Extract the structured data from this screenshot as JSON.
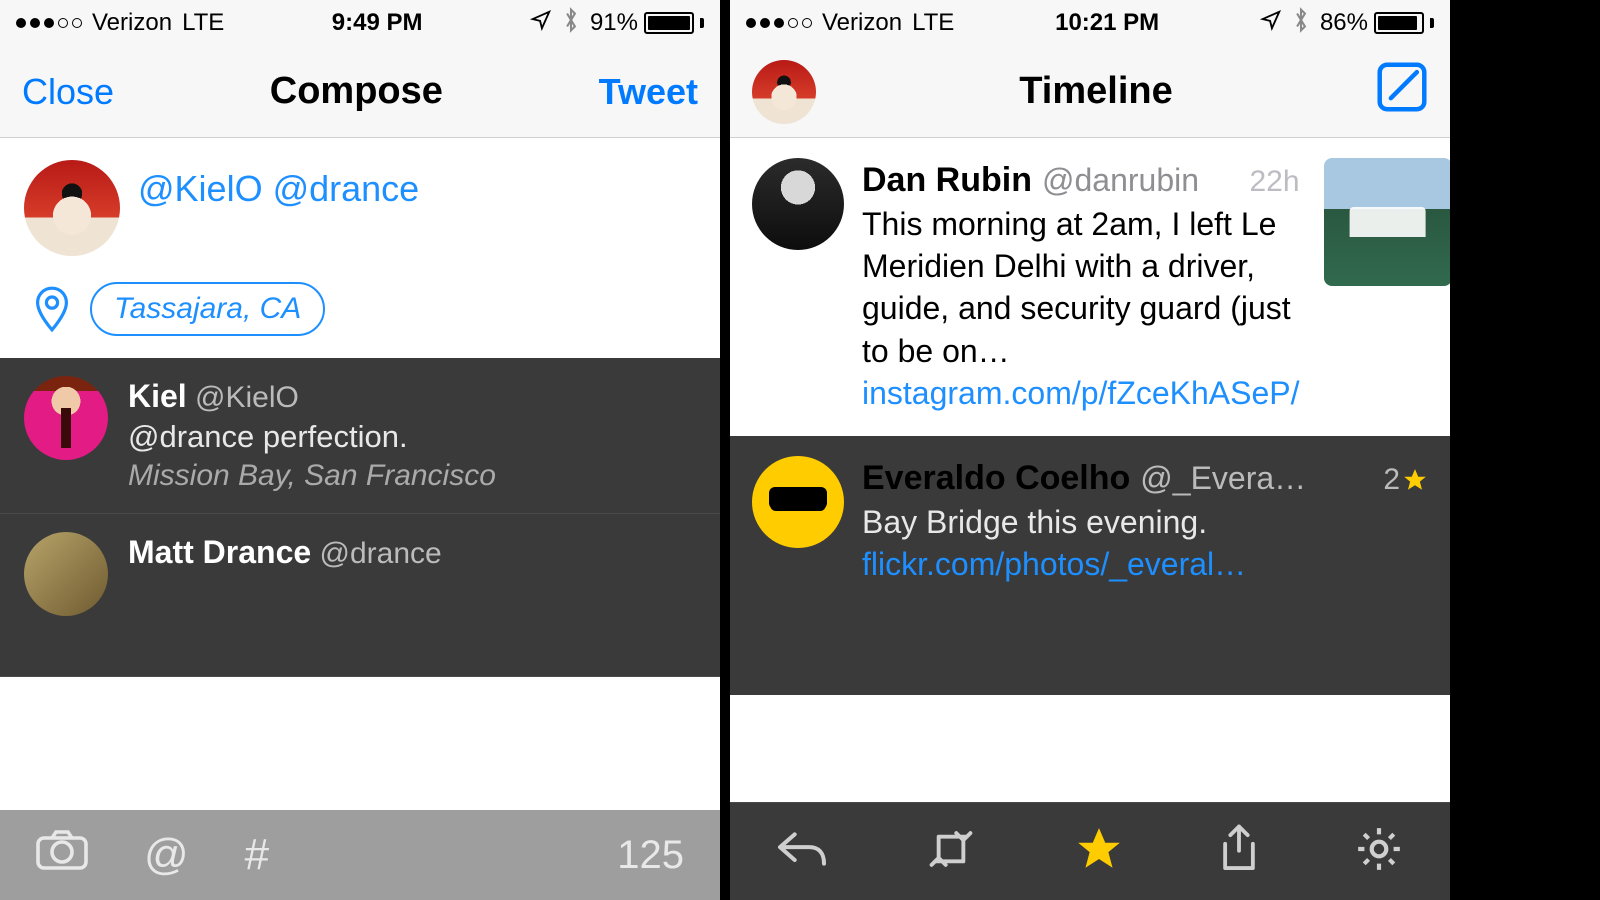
{
  "left": {
    "status": {
      "carrier": "Verizon",
      "net": "LTE",
      "time": "9:49 PM",
      "battery_pct": "91%",
      "signal_filled": 3
    },
    "nav": {
      "close": "Close",
      "title": "Compose",
      "tweet": "Tweet"
    },
    "compose": {
      "text": "@KielO @drance",
      "location": "Tassajara, CA"
    },
    "replies": [
      {
        "name": "Kiel",
        "handle": "@KielO",
        "text": "@drance perfection.",
        "location": "Mission Bay, San Francisco"
      },
      {
        "name": "Matt Drance",
        "handle": "@drance",
        "text": "",
        "location": ""
      }
    ],
    "toolbar": {
      "at": "@",
      "hash": "#",
      "count": "125"
    }
  },
  "right": {
    "status": {
      "carrier": "Verizon",
      "net": "LTE",
      "time": "10:21 PM",
      "battery_pct": "86%",
      "signal_filled": 3
    },
    "nav": {
      "title": "Timeline"
    },
    "tweets": [
      {
        "name": "Dan Rubin",
        "handle": "@danrubin",
        "time": "22h",
        "text": "This morning at 2am, I left Le Meridien Delhi with a driver, guide, and security guard (just to be on… ",
        "link": "instagram.com/p/fZceKhASeP/"
      },
      {
        "name": "Everaldo Coelho",
        "handle": "@_Evera…",
        "time": "2",
        "text": "Bay Bridge this evening.",
        "link": "flickr.com/photos/_everal…"
      }
    ]
  }
}
